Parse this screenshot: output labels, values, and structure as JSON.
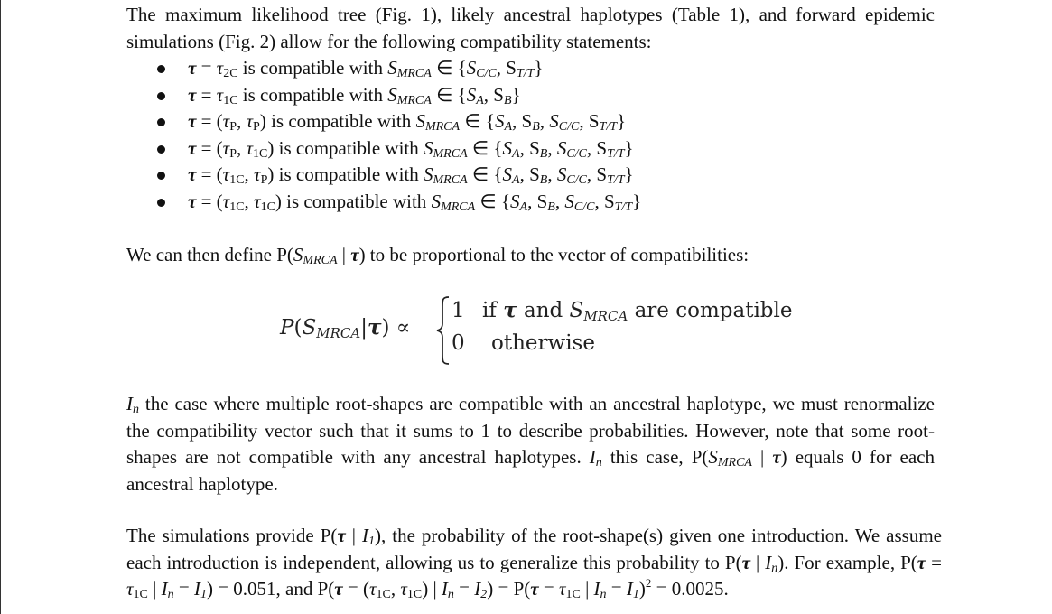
{
  "intro": {
    "text": "The maximum likelihood tree (Fig. 1), likely ancestral haplotypes (Table 1), and forward epidemic simulations (Fig. 2) allow for the following compatibility statements:"
  },
  "bullets": [
    "τ = τ2C is compatible with SMRCA ∈ {SC/C, ST/T}",
    "τ = τ1C is compatible with SMRCA ∈ {SA, SB}",
    "τ = (τP, τP) is compatible with SMRCA ∈ {SA, SB, SC/C, ST/T}",
    "τ = (τP, τ1C) is compatible with SMRCA ∈ {SA, SB, SC/C, ST/T}",
    "τ = (τ1C, τP) is compatible with SMRCA ∈ {SA, SB, SC/C, ST/T}",
    "τ = (τ1C, τ1C) is compatible with SMRCA ∈ {SA, SB, SC/C, ST/T}"
  ],
  "define": {
    "text": "We can then define P(SMRCA | τ) to be proportional to the vector of compatibilities:"
  },
  "equation": {
    "lhs": "P(SMRCA|τ) ∝",
    "case1_value": "1",
    "case1_condition": "if τ and SMRCA are compatible",
    "case2_value": "0",
    "case2_condition": "otherwise"
  },
  "renormalize": {
    "text": "In the case where multiple root-shapes are compatible with an ancestral haplotype, we must renormalize the compatibility vector such that it sums to 1 to describe probabilities. However, note that some root-shapes are not compatible with any ancestral haplotypes. In this case, P(SMRCA | τ) equals 0 for each ancestral haplotype."
  },
  "simulations": {
    "text": "The simulations provide P(τ | I1), the probability of the root-shape(s) given one introduction. We assume each introduction is independent, allowing us to generalize this probability to P(τ | In). For example, P(τ = τ1C | In = I1) = 0.051, and P(τ = (τ1C, τ1C) | In = I2) = P(τ = τ1C | In = I1)2 = 0.0025."
  }
}
